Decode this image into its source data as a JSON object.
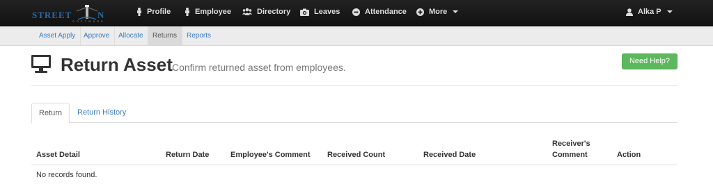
{
  "brand": {
    "word1": "STREET",
    "word2": "N",
    "tagline": "S O F T W A R E"
  },
  "topnav": {
    "items": [
      {
        "label": "Profile",
        "icon": "person-icon"
      },
      {
        "label": "Employee",
        "icon": "person-icon"
      },
      {
        "label": "Directory",
        "icon": "group-icon"
      },
      {
        "label": "Leaves",
        "icon": "camera-icon"
      },
      {
        "label": "Attendance",
        "icon": "minus-circle-icon"
      },
      {
        "label": "More",
        "icon": "plus-circle-icon"
      }
    ],
    "user": "Alka P"
  },
  "subnav": {
    "items": [
      "Asset Apply",
      "Approve",
      "Allocate",
      "Returns",
      "Reports"
    ],
    "active": "Returns"
  },
  "page": {
    "title": "Return Asset",
    "subtitle": "Confirm returned asset from employees.",
    "help_label": "Need Help?"
  },
  "tabs": [
    "Return",
    "Return History"
  ],
  "table": {
    "columns": [
      "Asset Detail",
      "Return Date",
      "Employee's Comment",
      "Received Count",
      "Received Date",
      "Receiver's",
      "Comment",
      "Action"
    ],
    "empty_text": "No records found."
  },
  "colors": {
    "accent": "#3a7cc0",
    "success": "#5cb85c",
    "nav_bg": "#1a1a1a"
  }
}
